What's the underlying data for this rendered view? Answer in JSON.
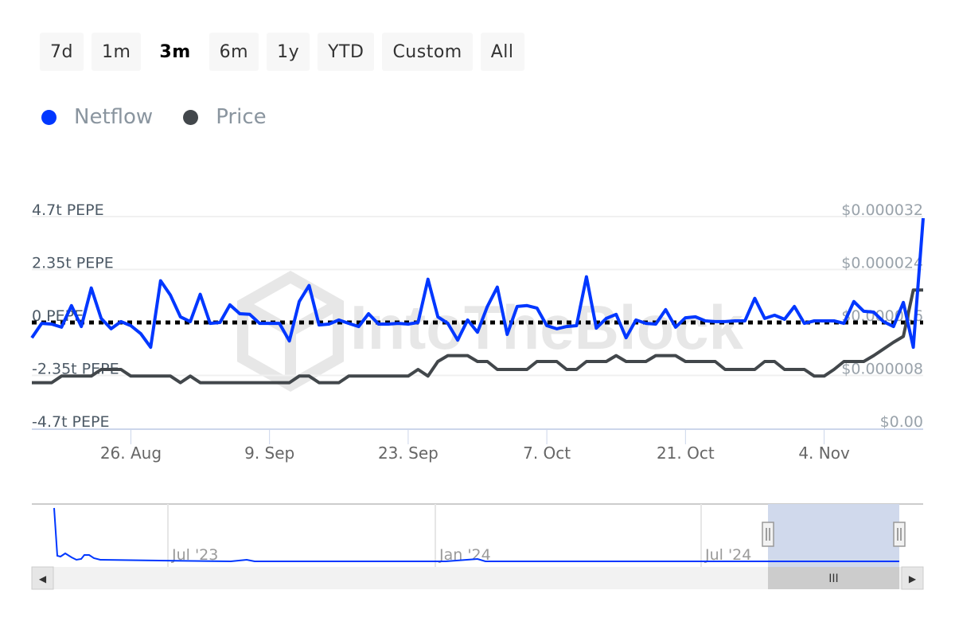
{
  "range_selector": {
    "buttons": [
      "7d",
      "1m",
      "3m",
      "6m",
      "1y",
      "YTD",
      "Custom",
      "All"
    ],
    "active": "3m"
  },
  "legend": {
    "items": [
      {
        "name": "Netflow",
        "color": "#0037ff"
      },
      {
        "name": "Price",
        "color": "#42474b"
      }
    ]
  },
  "watermark": "IntoTheBlock",
  "colors": {
    "netflow": "#0037ff",
    "price": "#42474b",
    "zero_line": "#000000",
    "navigator_mask": "#d0d9ec"
  },
  "chart_data": {
    "type": "line",
    "title": "",
    "start_date": "2024-08-16",
    "interval": "1 day",
    "x_tick_labels": [
      "26. Aug",
      "9. Sep",
      "23. Sep",
      "7. Oct",
      "21. Oct",
      "4. Nov"
    ],
    "x_tick_dates": [
      "2024-08-26",
      "2024-09-09",
      "2024-09-23",
      "2024-10-07",
      "2024-10-21",
      "2024-11-04"
    ],
    "y_left": {
      "label": "Netflow",
      "unit": "t PEPE",
      "range": [
        -4.7,
        4.7
      ],
      "ticks": [
        4.7,
        2.35,
        0,
        -2.35,
        -4.7
      ],
      "tick_labels": [
        "4.7t PEPE",
        "2.35t PEPE",
        "0 PEPE",
        "-2.35t PEPE",
        "-4.7t PEPE"
      ]
    },
    "y_right": {
      "label": "Price",
      "unit": "USD",
      "range": [
        0,
        3.2e-05
      ],
      "ticks": [
        3.2e-05,
        2.4e-05,
        1.6e-05,
        8e-06,
        0
      ],
      "tick_labels": [
        "$0.000032",
        "$0.000024",
        "$0.000016",
        "$0.000008",
        "$0.00"
      ]
    },
    "grid": true,
    "zero_line": "dotted",
    "legend_position": "top-left",
    "series": [
      {
        "name": "Netflow",
        "axis": "left",
        "unit": "trillion PEPE",
        "values": [
          -0.68,
          -0.04,
          -0.07,
          -0.21,
          0.75,
          -0.18,
          1.53,
          0.18,
          -0.28,
          0.04,
          -0.14,
          -0.5,
          -1.1,
          1.85,
          1.21,
          0.25,
          0.04,
          1.25,
          -0.04,
          0.0,
          0.78,
          0.39,
          0.36,
          -0.04,
          -0.04,
          -0.04,
          -0.82,
          0.93,
          1.64,
          -0.11,
          -0.07,
          0.11,
          -0.04,
          -0.18,
          0.39,
          -0.07,
          -0.07,
          -0.04,
          -0.07,
          0.0,
          1.92,
          0.25,
          -0.04,
          -0.78,
          0.11,
          -0.43,
          0.71,
          1.57,
          -0.53,
          0.71,
          0.75,
          0.64,
          -0.14,
          -0.28,
          -0.18,
          -0.14,
          2.03,
          -0.25,
          0.18,
          0.36,
          -0.68,
          0.11,
          -0.04,
          -0.07,
          0.57,
          -0.21,
          0.21,
          0.25,
          0.07,
          0.04,
          0.04,
          0.07,
          0.07,
          1.07,
          0.18,
          0.32,
          0.14,
          0.71,
          -0.04,
          0.07,
          0.07,
          0.07,
          -0.04,
          0.93,
          0.5,
          0.46,
          0.04,
          -0.18,
          0.89,
          -1.1,
          4.63
        ]
      },
      {
        "name": "Price",
        "axis": "right",
        "unit": "USD",
        "values": [
          6.9e-06,
          6.9e-06,
          6.9e-06,
          7.9e-06,
          7.9e-06,
          7.9e-06,
          7.9e-06,
          8.9e-06,
          8.9e-06,
          8.9e-06,
          7.9e-06,
          7.9e-06,
          7.9e-06,
          7.9e-06,
          7.9e-06,
          6.9e-06,
          7.9e-06,
          6.9e-06,
          6.9e-06,
          6.9e-06,
          6.9e-06,
          6.9e-06,
          6.9e-06,
          6.9e-06,
          6.9e-06,
          6.9e-06,
          6.9e-06,
          7.9e-06,
          7.9e-06,
          6.9e-06,
          6.9e-06,
          6.9e-06,
          7.9e-06,
          7.9e-06,
          7.9e-06,
          7.9e-06,
          7.9e-06,
          7.9e-06,
          7.9e-06,
          8.9e-06,
          7.9e-06,
          1.01e-05,
          1.1e-05,
          1.1e-05,
          1.1e-05,
          1.01e-05,
          1.01e-05,
          8.9e-06,
          8.9e-06,
          8.9e-06,
          8.9e-06,
          1.01e-05,
          1.01e-05,
          1.01e-05,
          8.9e-06,
          8.9e-06,
          1.01e-05,
          1.01e-05,
          1.01e-05,
          1.1e-05,
          1.01e-05,
          1.01e-05,
          1.01e-05,
          1.1e-05,
          1.1e-05,
          1.1e-05,
          1.01e-05,
          1.01e-05,
          1.01e-05,
          1.01e-05,
          8.9e-06,
          8.9e-06,
          8.9e-06,
          8.9e-06,
          1.01e-05,
          1.01e-05,
          8.9e-06,
          8.9e-06,
          8.9e-06,
          7.9e-06,
          7.9e-06,
          8.9e-06,
          1.01e-05,
          1.01e-05,
          1.01e-05,
          1.1e-05,
          1.2e-05,
          1.3e-05,
          1.39e-05,
          2.09e-05,
          2.09e-05
        ]
      }
    ]
  },
  "navigator": {
    "labels": [
      "Jul '23",
      "Jan '24",
      "Jul '24"
    ],
    "selected_fraction": [
      0.842,
      1.0
    ],
    "scrollbar": {
      "left_arrow": "◀",
      "right_arrow": "▶",
      "grip": "III"
    }
  }
}
